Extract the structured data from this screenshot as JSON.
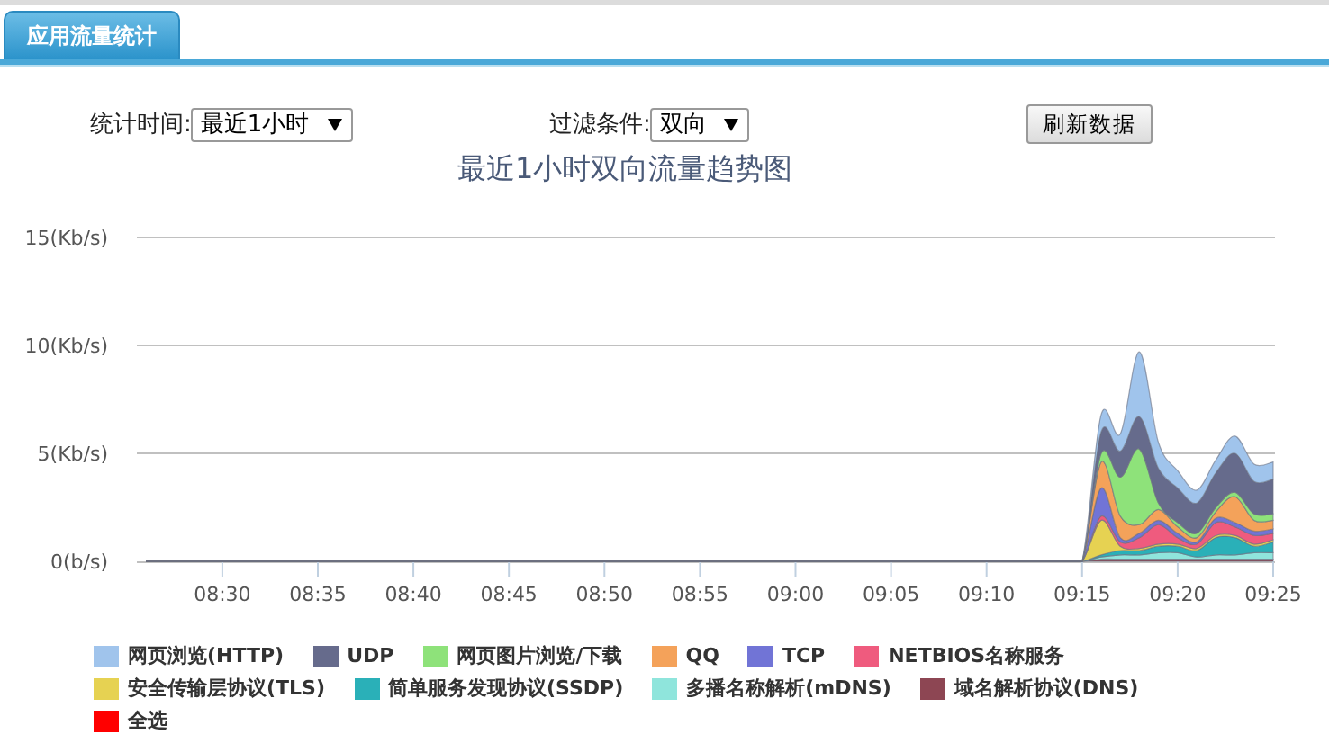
{
  "tabs": [
    {
      "label": "应用流量统计",
      "selected": true
    }
  ],
  "filters": [
    {
      "label": "统计时间:",
      "value": "最近1小时"
    },
    {
      "label": "过滤条件:",
      "value": "双向"
    }
  ],
  "refresh_button": "刷新数据",
  "chart": {
    "chart_data": {
      "type": "area",
      "stacked": true,
      "title": "最近1小时双向流量趋势图",
      "categories": [
        null,
        null,
        null,
        null,
        "08:30",
        null,
        null,
        null,
        null,
        "08:35",
        null,
        null,
        null,
        null,
        "08:40",
        null,
        null,
        null,
        null,
        "08:45",
        null,
        null,
        null,
        null,
        "08:50",
        null,
        null,
        null,
        null,
        "08:55",
        null,
        null,
        null,
        null,
        "09:00",
        null,
        null,
        null,
        null,
        "09:05",
        null,
        null,
        null,
        null,
        "09:10",
        null,
        null,
        null,
        null,
        "09:15",
        null,
        null,
        null,
        null,
        "09:20",
        null,
        null,
        null,
        null,
        "09:25"
      ],
      "ylim": [
        0,
        15
      ],
      "legend": "bottom",
      "yticks": [
        {
          "value": 0,
          "label": "0(b/s)"
        },
        {
          "value": 5,
          "label": "5(Kb/s)"
        },
        {
          "value": 10,
          "label": "10(Kb/s)"
        },
        {
          "value": 15,
          "label": "15(Kb/s)"
        }
      ],
      "series": [
        {
          "name": "网页浏览(HTTP)",
          "color": "#a0c4ec",
          "values": [
            0,
            0,
            0,
            0,
            0,
            0,
            0,
            0,
            0,
            0,
            0,
            0,
            0,
            0,
            0,
            0,
            0,
            0,
            0,
            0,
            0,
            0,
            0,
            0,
            0,
            0,
            0,
            0,
            0,
            0,
            0,
            0,
            0,
            0,
            0,
            0,
            0,
            0,
            0,
            0,
            0,
            0,
            0,
            0,
            0,
            0,
            0,
            0,
            0,
            0,
            0.8,
            0.8,
            3.0,
            1.2,
            0.8,
            0.6,
            0.6,
            0.8,
            0.8,
            0.8
          ]
        },
        {
          "name": "UDP",
          "color": "#666b8c",
          "values": [
            0,
            0,
            0,
            0,
            0,
            0,
            0,
            0,
            0,
            0,
            0,
            0,
            0,
            0,
            0,
            0,
            0,
            0,
            0,
            0,
            0,
            0,
            0,
            0,
            0,
            0,
            0,
            0,
            0,
            0,
            0,
            0,
            0,
            0,
            0,
            0,
            0,
            0,
            0,
            0,
            0,
            0,
            0,
            0,
            0,
            0,
            0,
            0,
            0,
            0,
            1.0,
            1.2,
            1.5,
            1.6,
            1.6,
            1.4,
            1.6,
            1.8,
            1.5,
            1.6
          ]
        },
        {
          "name": "网页图片浏览/下载",
          "color": "#8ee27a",
          "values": [
            0,
            0,
            0,
            0,
            0,
            0,
            0,
            0,
            0,
            0,
            0,
            0,
            0,
            0,
            0,
            0,
            0,
            0,
            0,
            0,
            0,
            0,
            0,
            0,
            0,
            0,
            0,
            0,
            0,
            0,
            0,
            0,
            0,
            0,
            0,
            0,
            0,
            0,
            0,
            0,
            0,
            0,
            0,
            0,
            0,
            0,
            0,
            0,
            0,
            0,
            0.4,
            1.8,
            3.5,
            0.3,
            0.2,
            0.2,
            0.2,
            0.2,
            0.3,
            0.3
          ]
        },
        {
          "name": "QQ",
          "color": "#f4a25a",
          "values": [
            0,
            0,
            0,
            0,
            0,
            0,
            0,
            0,
            0,
            0,
            0,
            0,
            0,
            0,
            0,
            0,
            0,
            0,
            0,
            0,
            0,
            0,
            0,
            0,
            0,
            0,
            0,
            0,
            0,
            0,
            0,
            0,
            0,
            0,
            0,
            0,
            0,
            0,
            0,
            0,
            0,
            0,
            0,
            0,
            0,
            0,
            0,
            0,
            0,
            0,
            1.2,
            1.0,
            0.4,
            0.5,
            0.3,
            0.2,
            0.3,
            1.2,
            0.5,
            0.4
          ]
        },
        {
          "name": "TCP",
          "color": "#7174d6",
          "values": [
            0,
            0,
            0,
            0,
            0,
            0,
            0,
            0,
            0,
            0,
            0,
            0,
            0,
            0,
            0,
            0,
            0,
            0,
            0,
            0,
            0,
            0,
            0,
            0,
            0,
            0,
            0,
            0,
            0,
            0,
            0,
            0,
            0,
            0,
            0,
            0,
            0,
            0,
            0,
            0,
            0,
            0,
            0,
            0,
            0,
            0,
            0,
            0,
            0,
            0,
            1.3,
            0.2,
            0.2,
            0.2,
            0.2,
            0.1,
            0.2,
            0.2,
            0.2,
            0.2
          ]
        },
        {
          "name": "NETBIOS名称服务",
          "color": "#ef5b7e",
          "values": [
            0,
            0,
            0,
            0,
            0,
            0,
            0,
            0,
            0,
            0,
            0,
            0,
            0,
            0,
            0,
            0,
            0,
            0,
            0,
            0,
            0,
            0,
            0,
            0,
            0,
            0,
            0,
            0,
            0,
            0,
            0,
            0,
            0,
            0,
            0,
            0,
            0,
            0,
            0,
            0,
            0,
            0,
            0,
            0,
            0,
            0,
            0,
            0,
            0,
            0,
            0.2,
            0.2,
            0.5,
            0.9,
            0.3,
            0.2,
            0.6,
            0.4,
            0.4,
            0.3
          ]
        },
        {
          "name": "安全传输层协议(TLS)",
          "color": "#e6d252",
          "values": [
            0,
            0,
            0,
            0,
            0,
            0,
            0,
            0,
            0,
            0,
            0,
            0,
            0,
            0,
            0,
            0,
            0,
            0,
            0,
            0,
            0,
            0,
            0,
            0,
            0,
            0,
            0,
            0,
            0,
            0,
            0,
            0,
            0,
            0,
            0,
            0,
            0,
            0,
            0,
            0,
            0,
            0,
            0,
            0,
            0,
            0,
            0,
            0,
            0,
            0,
            1.6,
            0.2,
            0.1,
            0.1,
            0.1,
            0.1,
            0.1,
            0.1,
            0.1,
            0.1
          ]
        },
        {
          "name": "简单服务发现协议(SSDP)",
          "color": "#2ab0b8",
          "values": [
            0,
            0,
            0,
            0,
            0,
            0,
            0,
            0,
            0,
            0,
            0,
            0,
            0,
            0,
            0,
            0,
            0,
            0,
            0,
            0,
            0,
            0,
            0,
            0,
            0,
            0,
            0,
            0,
            0,
            0,
            0,
            0,
            0,
            0,
            0,
            0,
            0,
            0,
            0,
            0,
            0,
            0,
            0,
            0,
            0,
            0,
            0,
            0,
            0,
            0,
            0.1,
            0.2,
            0.2,
            0.3,
            0.3,
            0.3,
            0.8,
            0.8,
            0.3,
            0.5
          ]
        },
        {
          "name": "多播名称解析(mDNS)",
          "color": "#8fe5dc",
          "values": [
            0,
            0,
            0,
            0,
            0,
            0,
            0,
            0,
            0,
            0,
            0,
            0,
            0,
            0,
            0,
            0,
            0,
            0,
            0,
            0,
            0,
            0,
            0,
            0,
            0,
            0,
            0,
            0,
            0,
            0,
            0,
            0,
            0,
            0,
            0,
            0,
            0,
            0,
            0,
            0,
            0,
            0,
            0,
            0,
            0,
            0,
            0,
            0,
            0,
            0,
            0.1,
            0.2,
            0.2,
            0.3,
            0.3,
            0.1,
            0.2,
            0.2,
            0.3,
            0.3
          ]
        },
        {
          "name": "域名解析协议(DNS)",
          "color": "#8d4653",
          "values": [
            0,
            0,
            0,
            0,
            0,
            0,
            0,
            0,
            0,
            0,
            0,
            0,
            0,
            0,
            0,
            0,
            0,
            0,
            0,
            0,
            0,
            0,
            0,
            0,
            0,
            0,
            0,
            0,
            0,
            0,
            0,
            0,
            0,
            0,
            0,
            0,
            0,
            0,
            0,
            0,
            0,
            0,
            0,
            0,
            0,
            0,
            0,
            0,
            0,
            0,
            0.1,
            0.1,
            0.1,
            0.1,
            0.1,
            0.1,
            0.1,
            0.1,
            0.1,
            0.1
          ]
        }
      ]
    },
    "select_all": {
      "label": "全选",
      "color": "#ff0000"
    }
  }
}
